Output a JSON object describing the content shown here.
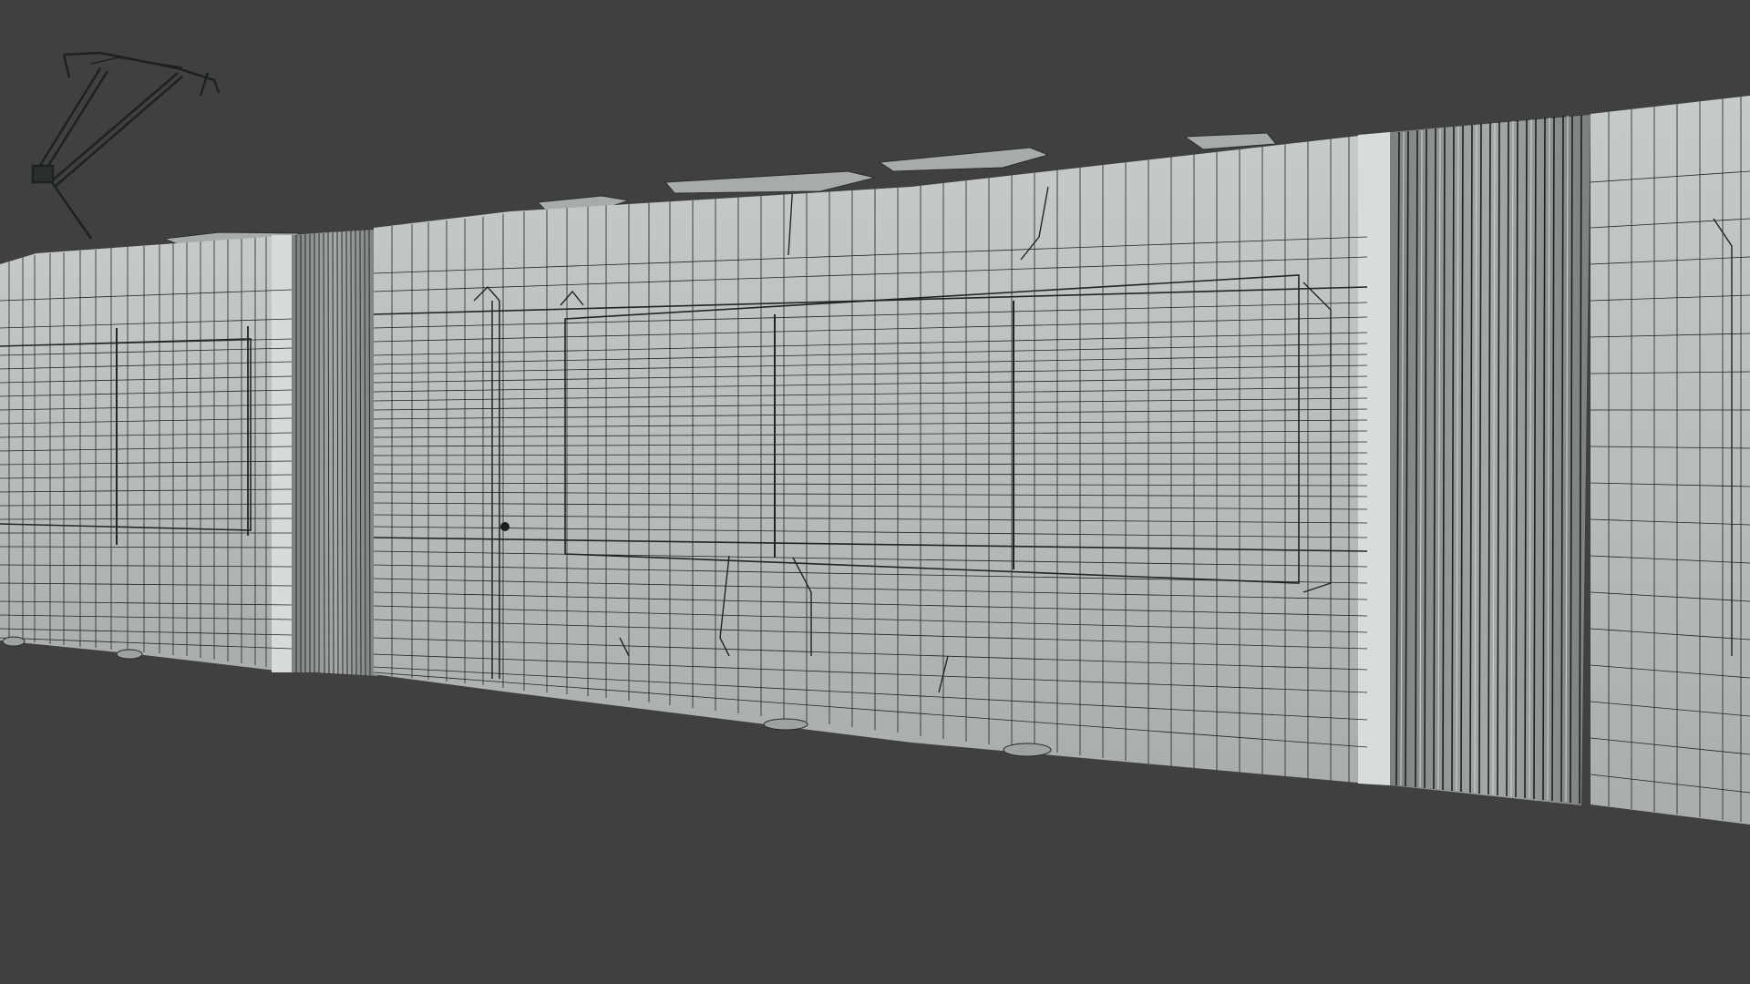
{
  "viewport": {
    "background_color": "#404040",
    "view_mode": "wireframe-on-shaded"
  },
  "model": {
    "subject": "articulated-tram",
    "body_color": "#b9bdbd",
    "body_highlight_color": "#d6d9d9",
    "wire_color": "#1e2222",
    "bellows_color": "#8d9191",
    "visible_parts": [
      "pantograph",
      "front-car",
      "bellows-1",
      "middle-car",
      "bellows-2",
      "rear-car",
      "wheels"
    ]
  }
}
